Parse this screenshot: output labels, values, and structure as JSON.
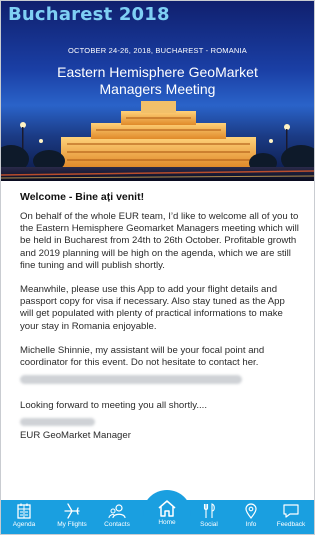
{
  "banner": {
    "brand": "Bucharest 2018",
    "date_line": "OCTOBER 24-26, 2018, BUCHAREST - ROMANIA",
    "title_line1": "Eastern Hemisphere GeoMarket",
    "title_line2": "Managers Meeting",
    "colors": {
      "brand": "#7fd0f4",
      "sky_top": "#10206e",
      "sky_mid": "#2a63c9"
    }
  },
  "content": {
    "heading": "Welcome - Bine ați venit!",
    "paragraphs": [
      "On behalf of the whole EUR team, I’d like to welcome all of you to the Eastern Hemisphere Geomarket Managers meeting which will be held in Bucharest from 24th to 26th October. Profitable growth and 2019 planning will be high on the agenda, which we are still fine tuning and will publish shortly.",
      "Meanwhile, please use this App to add your flight details and passport copy for visa if necessary. Also stay tuned as the App will get populated with plenty of practical informations to make your stay in Romania enjoyable.",
      "Michelle Shinnie, my assistant will be your focal point and coordinator for this event. Do not hesitate to contact her."
    ],
    "closing": "Looking forward to meeting you all shortly....",
    "signature_title": "EUR GeoMarket Manager"
  },
  "nav": {
    "accent": "#1a9fe0",
    "items": [
      {
        "label": "Agenda",
        "icon": "agenda-icon"
      },
      {
        "label": "My Flights",
        "icon": "plane-icon"
      },
      {
        "label": "Contacts",
        "icon": "contacts-icon"
      },
      {
        "label": "Home",
        "icon": "home-icon"
      },
      {
        "label": "Social",
        "icon": "social-icon"
      },
      {
        "label": "Info",
        "icon": "info-location-icon"
      },
      {
        "label": "Feedback",
        "icon": "feedback-icon"
      }
    ]
  }
}
